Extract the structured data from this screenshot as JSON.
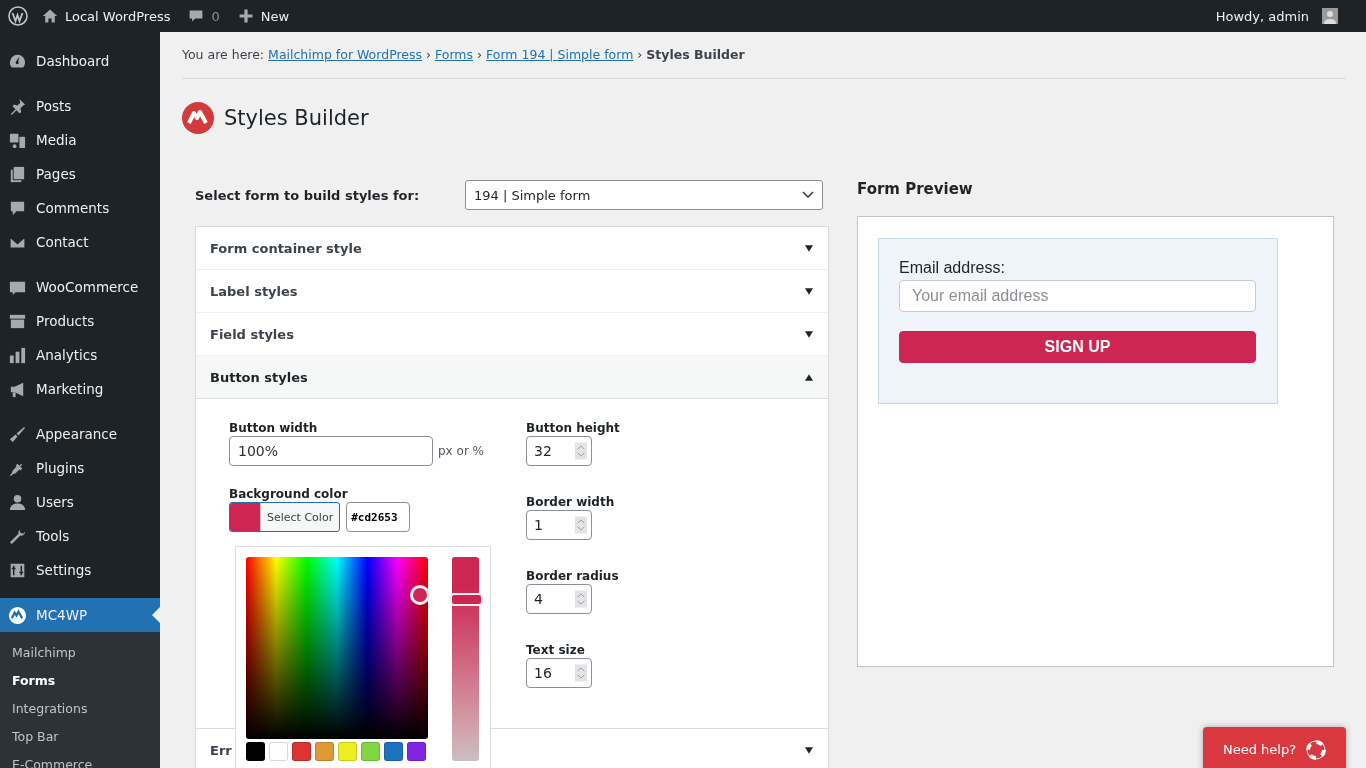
{
  "admin_bar": {
    "site": "Local WordPress",
    "comments": "0",
    "new": "New",
    "greeting": "Howdy, admin"
  },
  "sidebar": {
    "groups": [
      [
        {
          "label": "Dashboard",
          "selected": false
        }
      ],
      [
        {
          "label": "Posts",
          "selected": false
        },
        {
          "label": "Media",
          "selected": false
        },
        {
          "label": "Pages",
          "selected": false
        },
        {
          "label": "Comments",
          "selected": false
        },
        {
          "label": "Contact",
          "selected": false
        }
      ],
      [
        {
          "label": "WooCommerce",
          "selected": false
        },
        {
          "label": "Products",
          "selected": false
        },
        {
          "label": "Analytics",
          "selected": false
        },
        {
          "label": "Marketing",
          "selected": false
        }
      ],
      [
        {
          "label": "Appearance",
          "selected": false
        },
        {
          "label": "Plugins",
          "selected": false
        },
        {
          "label": "Users",
          "selected": false
        },
        {
          "label": "Tools",
          "selected": false
        },
        {
          "label": "Settings",
          "selected": false
        }
      ],
      [
        {
          "label": "MC4WP",
          "selected": true,
          "submenu": [
            {
              "label": "Mailchimp",
              "selected": false
            },
            {
              "label": "Forms",
              "selected": true
            },
            {
              "label": "Integrations",
              "selected": false
            },
            {
              "label": "Top Bar",
              "selected": false
            },
            {
              "label": "E-Commerce",
              "selected": false
            }
          ]
        }
      ]
    ]
  },
  "breadcrumb": {
    "prefix": "You are here:",
    "links": [
      "Mailchimp for WordPress",
      "Forms",
      "Form 194 | Simple form"
    ],
    "separator": "›",
    "current": "Styles Builder"
  },
  "title": "Styles Builder",
  "form_select": {
    "label": "Select form to build styles for:",
    "value": "194 | Simple form"
  },
  "accordion": [
    {
      "label": "Form container style",
      "expanded": false
    },
    {
      "label": "Label styles",
      "expanded": false
    },
    {
      "label": "Field styles",
      "expanded": false
    },
    {
      "label": "Button styles",
      "expanded": true
    },
    {
      "label": "Err",
      "expanded": false
    }
  ],
  "button_styles": {
    "width": {
      "label": "Button width",
      "value": "100%",
      "unit": "px or %"
    },
    "background_color": {
      "label": "Background color",
      "button": "Select Color",
      "color": "#cd2653",
      "hex": "#cd2653"
    },
    "color_picker": {
      "level": 0.8,
      "palette": [
        {
          "color": "#000000"
        },
        {
          "color": "#ffffff"
        },
        {
          "color": "#dd3333"
        },
        {
          "color": "#dd9933"
        },
        {
          "color": "#eeee22"
        },
        {
          "color": "#81d742"
        },
        {
          "color": "#1e73be"
        },
        {
          "color": "#8224e3"
        }
      ]
    },
    "numbers": [
      {
        "label": "Button height",
        "value": "32"
      },
      {
        "label": "Border width",
        "value": "1"
      },
      {
        "label": "Border radius",
        "value": "4"
      },
      {
        "label": "Text size",
        "value": "16"
      }
    ]
  },
  "preview": {
    "title": "Form Preview",
    "field_label": "Email address:",
    "placeholder": "Your email address",
    "button": "SIGN UP"
  },
  "help_button": "Need help?"
}
